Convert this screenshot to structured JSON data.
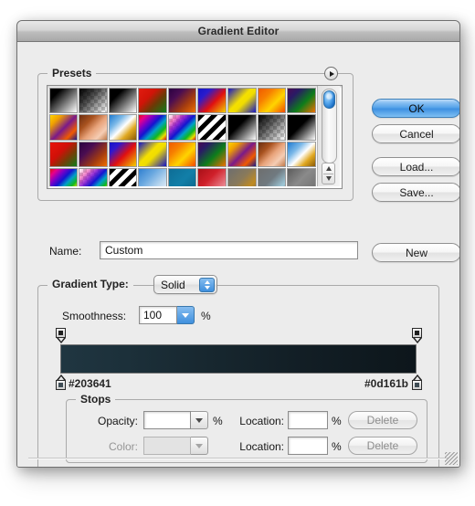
{
  "window": {
    "title": "Gradient Editor"
  },
  "presets": {
    "group_label": "Presets",
    "menu_icon": "presets-menu-arrow-icon",
    "scrollbar": {
      "up_icon": "scroll-up-arrow-icon",
      "down_icon": "scroll-down-arrow-icon"
    },
    "swatches": [
      {
        "name": "black-white",
        "css": "linear-gradient(135deg, #000000 0%, #000000 22%, #ffffff 100%)"
      },
      {
        "name": "black-transparent",
        "checker": true,
        "css": "linear-gradient(135deg, #000000 0%, rgba(0,0,0,0.75) 35%, rgba(0,0,0,0) 100%)"
      },
      {
        "name": "black-white-2",
        "css": "linear-gradient(135deg, #000000 0%, #000000 28%, #ffffff 100%)"
      },
      {
        "name": "red-green",
        "css": "linear-gradient(135deg, #e11b10 0%, #d01408 35%, #6b3a06 62%, #0d7d1b 100%)"
      },
      {
        "name": "purple-orange",
        "css": "linear-gradient(135deg, #2a0140 0%, #4a0d52 30%, #a33b10 65%, #f07000 100%)"
      },
      {
        "name": "blue-red-yellow",
        "css": "linear-gradient(135deg, #1414c8 0%, #2a1ccd 25%, #e01010 58%, #f2d000 100%)"
      },
      {
        "name": "blue-yellow-blue",
        "css": "linear-gradient(135deg, #1414c8 0%, #f5e000 45%, #f0dd00 58%, #1414c8 100%)"
      },
      {
        "name": "orange-yellow",
        "css": "linear-gradient(135deg, #f05a00 0%, #f78000 30%, #ffd400 62%, #f24a00 100%)"
      },
      {
        "name": "purple-green-orange",
        "css": "linear-gradient(135deg, #4a0a52 0%, #2a1a66 25%, #0d7d1b 60%, #f07000 100%)"
      },
      {
        "name": "yellow-purple-orange",
        "css": "linear-gradient(135deg, #ffd400 0%, #f0a000 22%, #7a1a8a 52%, #f05a00 78%, #1a1a8a 100%)"
      },
      {
        "name": "copper",
        "css": "linear-gradient(135deg, #6b2e10 0%, #a8521f 30%, #e8a37a 55%, #f5cdb4 78%, #c07a4a 100%)"
      },
      {
        "name": "blue-white-gold",
        "css": "linear-gradient(135deg, #1e7ad0 0%, #7ab8e8 28%, #ffffff 50%, #e0a820 72%, #8a5a08 100%)"
      },
      {
        "name": "spectrum",
        "css": "linear-gradient(135deg, #e01010 0%, #e8008a 14%, #7a00c8 30%, #1414d0 45%, #00a0c8 60%, #10b820 75%, #e8e000 88%, #e01010 100%)"
      },
      {
        "name": "spectrum-transparent",
        "checker": true,
        "css": "linear-gradient(135deg, rgba(224,16,16,0) 0%, rgba(232,0,138,0.5) 18%, rgba(122,0,200,0.85) 34%, #1414d0 50%, #00a0c8 64%, #10b820 78%, #e8e000 90%, #e01010 100%)"
      },
      {
        "name": "black-stripes",
        "css": "repeating-linear-gradient(135deg, #000000 0px, #000000 5px, #ffffff 5px, #ffffff 10px)"
      },
      {
        "name": "black-white-3",
        "css": "linear-gradient(135deg, #000000 0%, #000000 40%, #ffffff 100%)"
      },
      {
        "name": "black-checker",
        "checker": true,
        "css": "linear-gradient(135deg, #000000 0%, rgba(0,0,0,0.6) 45%, rgba(0,0,0,0) 100%)"
      },
      {
        "name": "black-white-4",
        "css": "linear-gradient(135deg, #000000 0%, #000000 45%, #ffffff 100%)"
      },
      {
        "name": "red-green-2",
        "css": "linear-gradient(135deg, #e8140a 0%, #d01008 40%, #7a3a06 65%, #0d7d1b 100%)"
      },
      {
        "name": "purple-brown",
        "css": "linear-gradient(135deg, #2a0140 0%, #4a0d52 32%, #a33b10 68%, #f07000 100%)"
      },
      {
        "name": "blue-red-yellow-2",
        "css": "linear-gradient(135deg, #1414c8 0%, #3018cd 22%, #e01010 55%, #f2d000 100%)"
      },
      {
        "name": "blue-yellow-blue-2",
        "css": "linear-gradient(135deg, #1414c8 0%, #f5e000 42%, #f0dd00 56%, #1414c8 100%)"
      },
      {
        "name": "orange-yellow-2",
        "css": "linear-gradient(135deg, #f05a00 0%, #f78000 28%, #ffd400 60%, #f24a00 100%)"
      },
      {
        "name": "purple-green-orange-2",
        "css": "linear-gradient(135deg, #4a0a52 0%, #2a1a66 22%, #0d7d1b 58%, #f07000 100%)"
      },
      {
        "name": "yellow-purple-orange-2",
        "css": "linear-gradient(135deg, #ffd400 0%, #f0a000 20%, #7a1a8a 50%, #f05a00 76%, #1a1a8a 100%)"
      },
      {
        "name": "copper-2",
        "css": "linear-gradient(135deg, #6b2e10 0%, #a8521f 28%, #e8a37a 52%, #f5cdb4 75%, #c07a4a 100%)"
      },
      {
        "name": "blue-white-gold-2",
        "css": "linear-gradient(135deg, #1e7ad0 0%, #7ab8e8 30%, #ffffff 52%, #e0a820 74%, #8a5a08 100%)"
      },
      {
        "name": "spectrum-2",
        "css": "linear-gradient(135deg, #e01010 0%, #e8008a 14%, #7a00c8 30%, #1414d0 45%, #00a0c8 60%, #10b820 75%, #e8e000 88%, #e01010 100%)"
      },
      {
        "name": "spectrum-transparent-2",
        "checker": true,
        "css": "linear-gradient(135deg, rgba(224,16,16,0) 0%, rgba(232,0,138,0.45) 20%, rgba(122,0,200,0.8) 36%, #1414d0 52%, #00a0c8 66%, #10b820 80%, #e8e000 92%, #e01010 100%)"
      },
      {
        "name": "black-stripes-2",
        "css": "repeating-linear-gradient(135deg, #000000 0px, #000000 5px, #ffffff 5px, #ffffff 10px)"
      },
      {
        "name": "blue-white",
        "css": "linear-gradient(135deg, #2f7fd0 0%, #6aa8e0 35%, #bcd8ef 70%, #eef4fa 100%)"
      },
      {
        "name": "teal-solid",
        "css": "linear-gradient(135deg, #0e6d96 0%, #127fa8 50%, #0b6287 100%)"
      },
      {
        "name": "red-pink",
        "css": "linear-gradient(135deg, #a81018 0%, #d0202a 40%, #e8808a 80%, #f2c0c4 100%)"
      },
      {
        "name": "grey-orange",
        "css": "linear-gradient(135deg, #6e6e6e 0%, #8a7a5a 45%, #c08a20 75%, #6e6e6e 100%)"
      },
      {
        "name": "grey-teal",
        "css": "linear-gradient(135deg, #6e6e6e 0%, #707a80 45%, #9ec8d8 80%, #6e6e6e 100%)"
      },
      {
        "name": "grey-solid",
        "css": "linear-gradient(135deg, #5c5c5c 0%, #8a8a8a 45%, #6e6e6e 100%)"
      }
    ]
  },
  "buttons": {
    "ok": "OK",
    "cancel": "Cancel",
    "load": "Load...",
    "save": "Save...",
    "new": "New"
  },
  "name_row": {
    "label": "Name:",
    "value": "Custom"
  },
  "gradient_type": {
    "label": "Gradient Type:",
    "value": "Solid",
    "stepper_icon": "stepper-up-down-icon"
  },
  "smoothness": {
    "label": "Smoothness:",
    "value": "100",
    "unit": "%",
    "arrow_icon": "chevron-down-icon"
  },
  "gradient": {
    "start_color": "#203641",
    "end_color": "#0d161b",
    "start_label": "#203641",
    "end_label": "#0d161b",
    "css": "linear-gradient(to right, #203641 0%, #1c303a 18%, #17272f 42%, #121e25 68%, #0d161b 100%)",
    "opacity_stop_icon": "opacity-stop-icon",
    "color_stop_icon": "color-stop-icon"
  },
  "stops": {
    "group_label": "Stops",
    "opacity_label": "Opacity:",
    "opacity_value": "",
    "opacity_unit": "%",
    "opacity_location_label": "Location:",
    "opacity_location_value": "",
    "opacity_location_unit": "%",
    "opacity_delete": "Delete",
    "color_label": "Color:",
    "color_value": "",
    "color_location_label": "Location:",
    "color_location_value": "",
    "color_location_unit": "%",
    "color_delete": "Delete"
  },
  "resize_grip_icon": "resize-grip-icon"
}
